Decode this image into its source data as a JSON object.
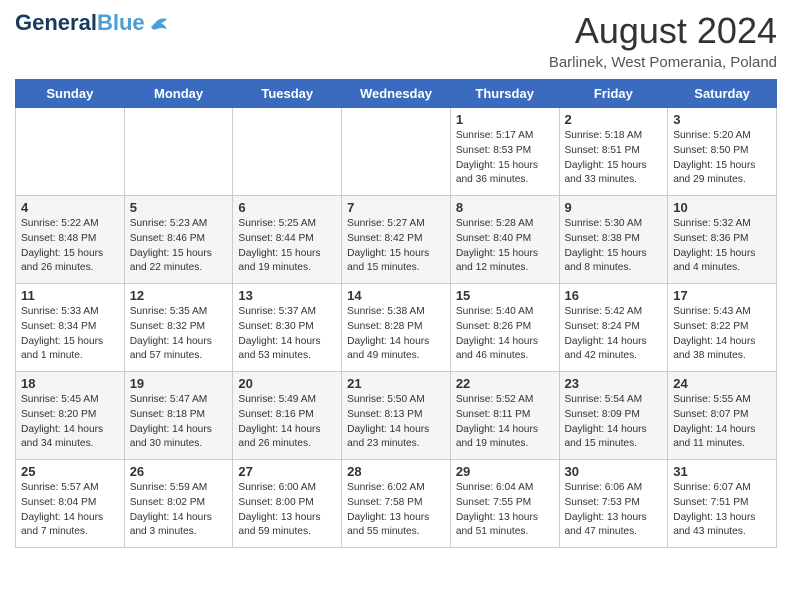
{
  "header": {
    "logo_line1": "General",
    "logo_line2": "Blue",
    "title": "August 2024",
    "location": "Barlinek, West Pomerania, Poland"
  },
  "days_of_week": [
    "Sunday",
    "Monday",
    "Tuesday",
    "Wednesday",
    "Thursday",
    "Friday",
    "Saturday"
  ],
  "weeks": [
    [
      {
        "day": "",
        "info": ""
      },
      {
        "day": "",
        "info": ""
      },
      {
        "day": "",
        "info": ""
      },
      {
        "day": "",
        "info": ""
      },
      {
        "day": "1",
        "info": "Sunrise: 5:17 AM\nSunset: 8:53 PM\nDaylight: 15 hours\nand 36 minutes."
      },
      {
        "day": "2",
        "info": "Sunrise: 5:18 AM\nSunset: 8:51 PM\nDaylight: 15 hours\nand 33 minutes."
      },
      {
        "day": "3",
        "info": "Sunrise: 5:20 AM\nSunset: 8:50 PM\nDaylight: 15 hours\nand 29 minutes."
      }
    ],
    [
      {
        "day": "4",
        "info": "Sunrise: 5:22 AM\nSunset: 8:48 PM\nDaylight: 15 hours\nand 26 minutes."
      },
      {
        "day": "5",
        "info": "Sunrise: 5:23 AM\nSunset: 8:46 PM\nDaylight: 15 hours\nand 22 minutes."
      },
      {
        "day": "6",
        "info": "Sunrise: 5:25 AM\nSunset: 8:44 PM\nDaylight: 15 hours\nand 19 minutes."
      },
      {
        "day": "7",
        "info": "Sunrise: 5:27 AM\nSunset: 8:42 PM\nDaylight: 15 hours\nand 15 minutes."
      },
      {
        "day": "8",
        "info": "Sunrise: 5:28 AM\nSunset: 8:40 PM\nDaylight: 15 hours\nand 12 minutes."
      },
      {
        "day": "9",
        "info": "Sunrise: 5:30 AM\nSunset: 8:38 PM\nDaylight: 15 hours\nand 8 minutes."
      },
      {
        "day": "10",
        "info": "Sunrise: 5:32 AM\nSunset: 8:36 PM\nDaylight: 15 hours\nand 4 minutes."
      }
    ],
    [
      {
        "day": "11",
        "info": "Sunrise: 5:33 AM\nSunset: 8:34 PM\nDaylight: 15 hours\nand 1 minute."
      },
      {
        "day": "12",
        "info": "Sunrise: 5:35 AM\nSunset: 8:32 PM\nDaylight: 14 hours\nand 57 minutes."
      },
      {
        "day": "13",
        "info": "Sunrise: 5:37 AM\nSunset: 8:30 PM\nDaylight: 14 hours\nand 53 minutes."
      },
      {
        "day": "14",
        "info": "Sunrise: 5:38 AM\nSunset: 8:28 PM\nDaylight: 14 hours\nand 49 minutes."
      },
      {
        "day": "15",
        "info": "Sunrise: 5:40 AM\nSunset: 8:26 PM\nDaylight: 14 hours\nand 46 minutes."
      },
      {
        "day": "16",
        "info": "Sunrise: 5:42 AM\nSunset: 8:24 PM\nDaylight: 14 hours\nand 42 minutes."
      },
      {
        "day": "17",
        "info": "Sunrise: 5:43 AM\nSunset: 8:22 PM\nDaylight: 14 hours\nand 38 minutes."
      }
    ],
    [
      {
        "day": "18",
        "info": "Sunrise: 5:45 AM\nSunset: 8:20 PM\nDaylight: 14 hours\nand 34 minutes."
      },
      {
        "day": "19",
        "info": "Sunrise: 5:47 AM\nSunset: 8:18 PM\nDaylight: 14 hours\nand 30 minutes."
      },
      {
        "day": "20",
        "info": "Sunrise: 5:49 AM\nSunset: 8:16 PM\nDaylight: 14 hours\nand 26 minutes."
      },
      {
        "day": "21",
        "info": "Sunrise: 5:50 AM\nSunset: 8:13 PM\nDaylight: 14 hours\nand 23 minutes."
      },
      {
        "day": "22",
        "info": "Sunrise: 5:52 AM\nSunset: 8:11 PM\nDaylight: 14 hours\nand 19 minutes."
      },
      {
        "day": "23",
        "info": "Sunrise: 5:54 AM\nSunset: 8:09 PM\nDaylight: 14 hours\nand 15 minutes."
      },
      {
        "day": "24",
        "info": "Sunrise: 5:55 AM\nSunset: 8:07 PM\nDaylight: 14 hours\nand 11 minutes."
      }
    ],
    [
      {
        "day": "25",
        "info": "Sunrise: 5:57 AM\nSunset: 8:04 PM\nDaylight: 14 hours\nand 7 minutes."
      },
      {
        "day": "26",
        "info": "Sunrise: 5:59 AM\nSunset: 8:02 PM\nDaylight: 14 hours\nand 3 minutes."
      },
      {
        "day": "27",
        "info": "Sunrise: 6:00 AM\nSunset: 8:00 PM\nDaylight: 13 hours\nand 59 minutes."
      },
      {
        "day": "28",
        "info": "Sunrise: 6:02 AM\nSunset: 7:58 PM\nDaylight: 13 hours\nand 55 minutes."
      },
      {
        "day": "29",
        "info": "Sunrise: 6:04 AM\nSunset: 7:55 PM\nDaylight: 13 hours\nand 51 minutes."
      },
      {
        "day": "30",
        "info": "Sunrise: 6:06 AM\nSunset: 7:53 PM\nDaylight: 13 hours\nand 47 minutes."
      },
      {
        "day": "31",
        "info": "Sunrise: 6:07 AM\nSunset: 7:51 PM\nDaylight: 13 hours\nand 43 minutes."
      }
    ]
  ]
}
